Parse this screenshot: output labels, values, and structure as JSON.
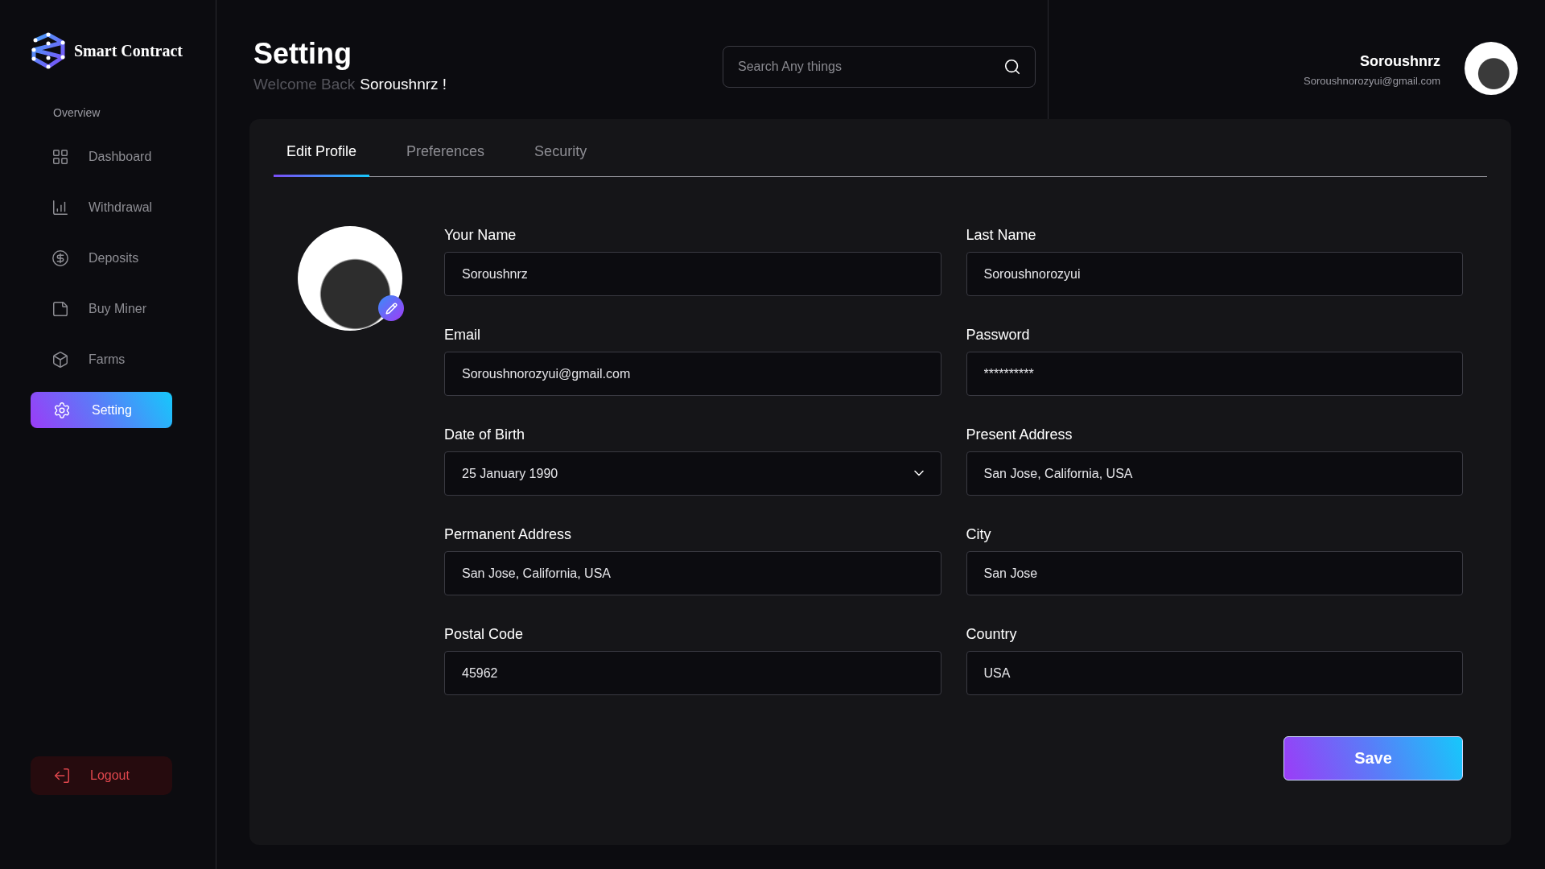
{
  "sidebar": {
    "brand": "Smart Contract",
    "section": "Overview",
    "items": [
      {
        "label": "Dashboard",
        "selected": false
      },
      {
        "label": "Withdrawal",
        "selected": false
      },
      {
        "label": "Deposits",
        "selected": false
      },
      {
        "label": "Buy Miner",
        "selected": false
      },
      {
        "label": "Farms",
        "selected": false
      },
      {
        "label": "Setting",
        "selected": true
      }
    ],
    "logout": "Logout"
  },
  "header": {
    "title": "Setting",
    "welcome": "Welcome Back",
    "name": "Soroushnrz !"
  },
  "search": {
    "placeholder": "Search Any things"
  },
  "user": {
    "name": "Soroushnrz",
    "email": "Soroushnorozyui@gmail.com"
  },
  "tabs": [
    {
      "label": "Edit Profile",
      "selected": true
    },
    {
      "label": "Preferences",
      "selected": false
    },
    {
      "label": "Security",
      "selected": false
    }
  ],
  "fields": [
    {
      "label": "Your Name",
      "value": "Soroushnrz",
      "kind": "text"
    },
    {
      "label": "Last Name",
      "value": "Soroushnorozyui",
      "kind": "text"
    },
    {
      "label": "Email",
      "value": "Soroushnorozyui@gmail.com",
      "kind": "text"
    },
    {
      "label": "Password",
      "value": "**********",
      "kind": "text"
    },
    {
      "label": "Date of Birth",
      "value": "25 January 1990",
      "kind": "select"
    },
    {
      "label": "Present Address",
      "value": "San Jose, California, USA",
      "kind": "text"
    },
    {
      "label": "Permanent Address",
      "value": "San Jose, California, USA",
      "kind": "text"
    },
    {
      "label": "City",
      "value": "San Jose",
      "kind": "text"
    },
    {
      "label": "Postal Code",
      "value": "45962",
      "kind": "text"
    },
    {
      "label": "Country",
      "value": "USA",
      "kind": "text"
    }
  ],
  "save": "Save"
}
